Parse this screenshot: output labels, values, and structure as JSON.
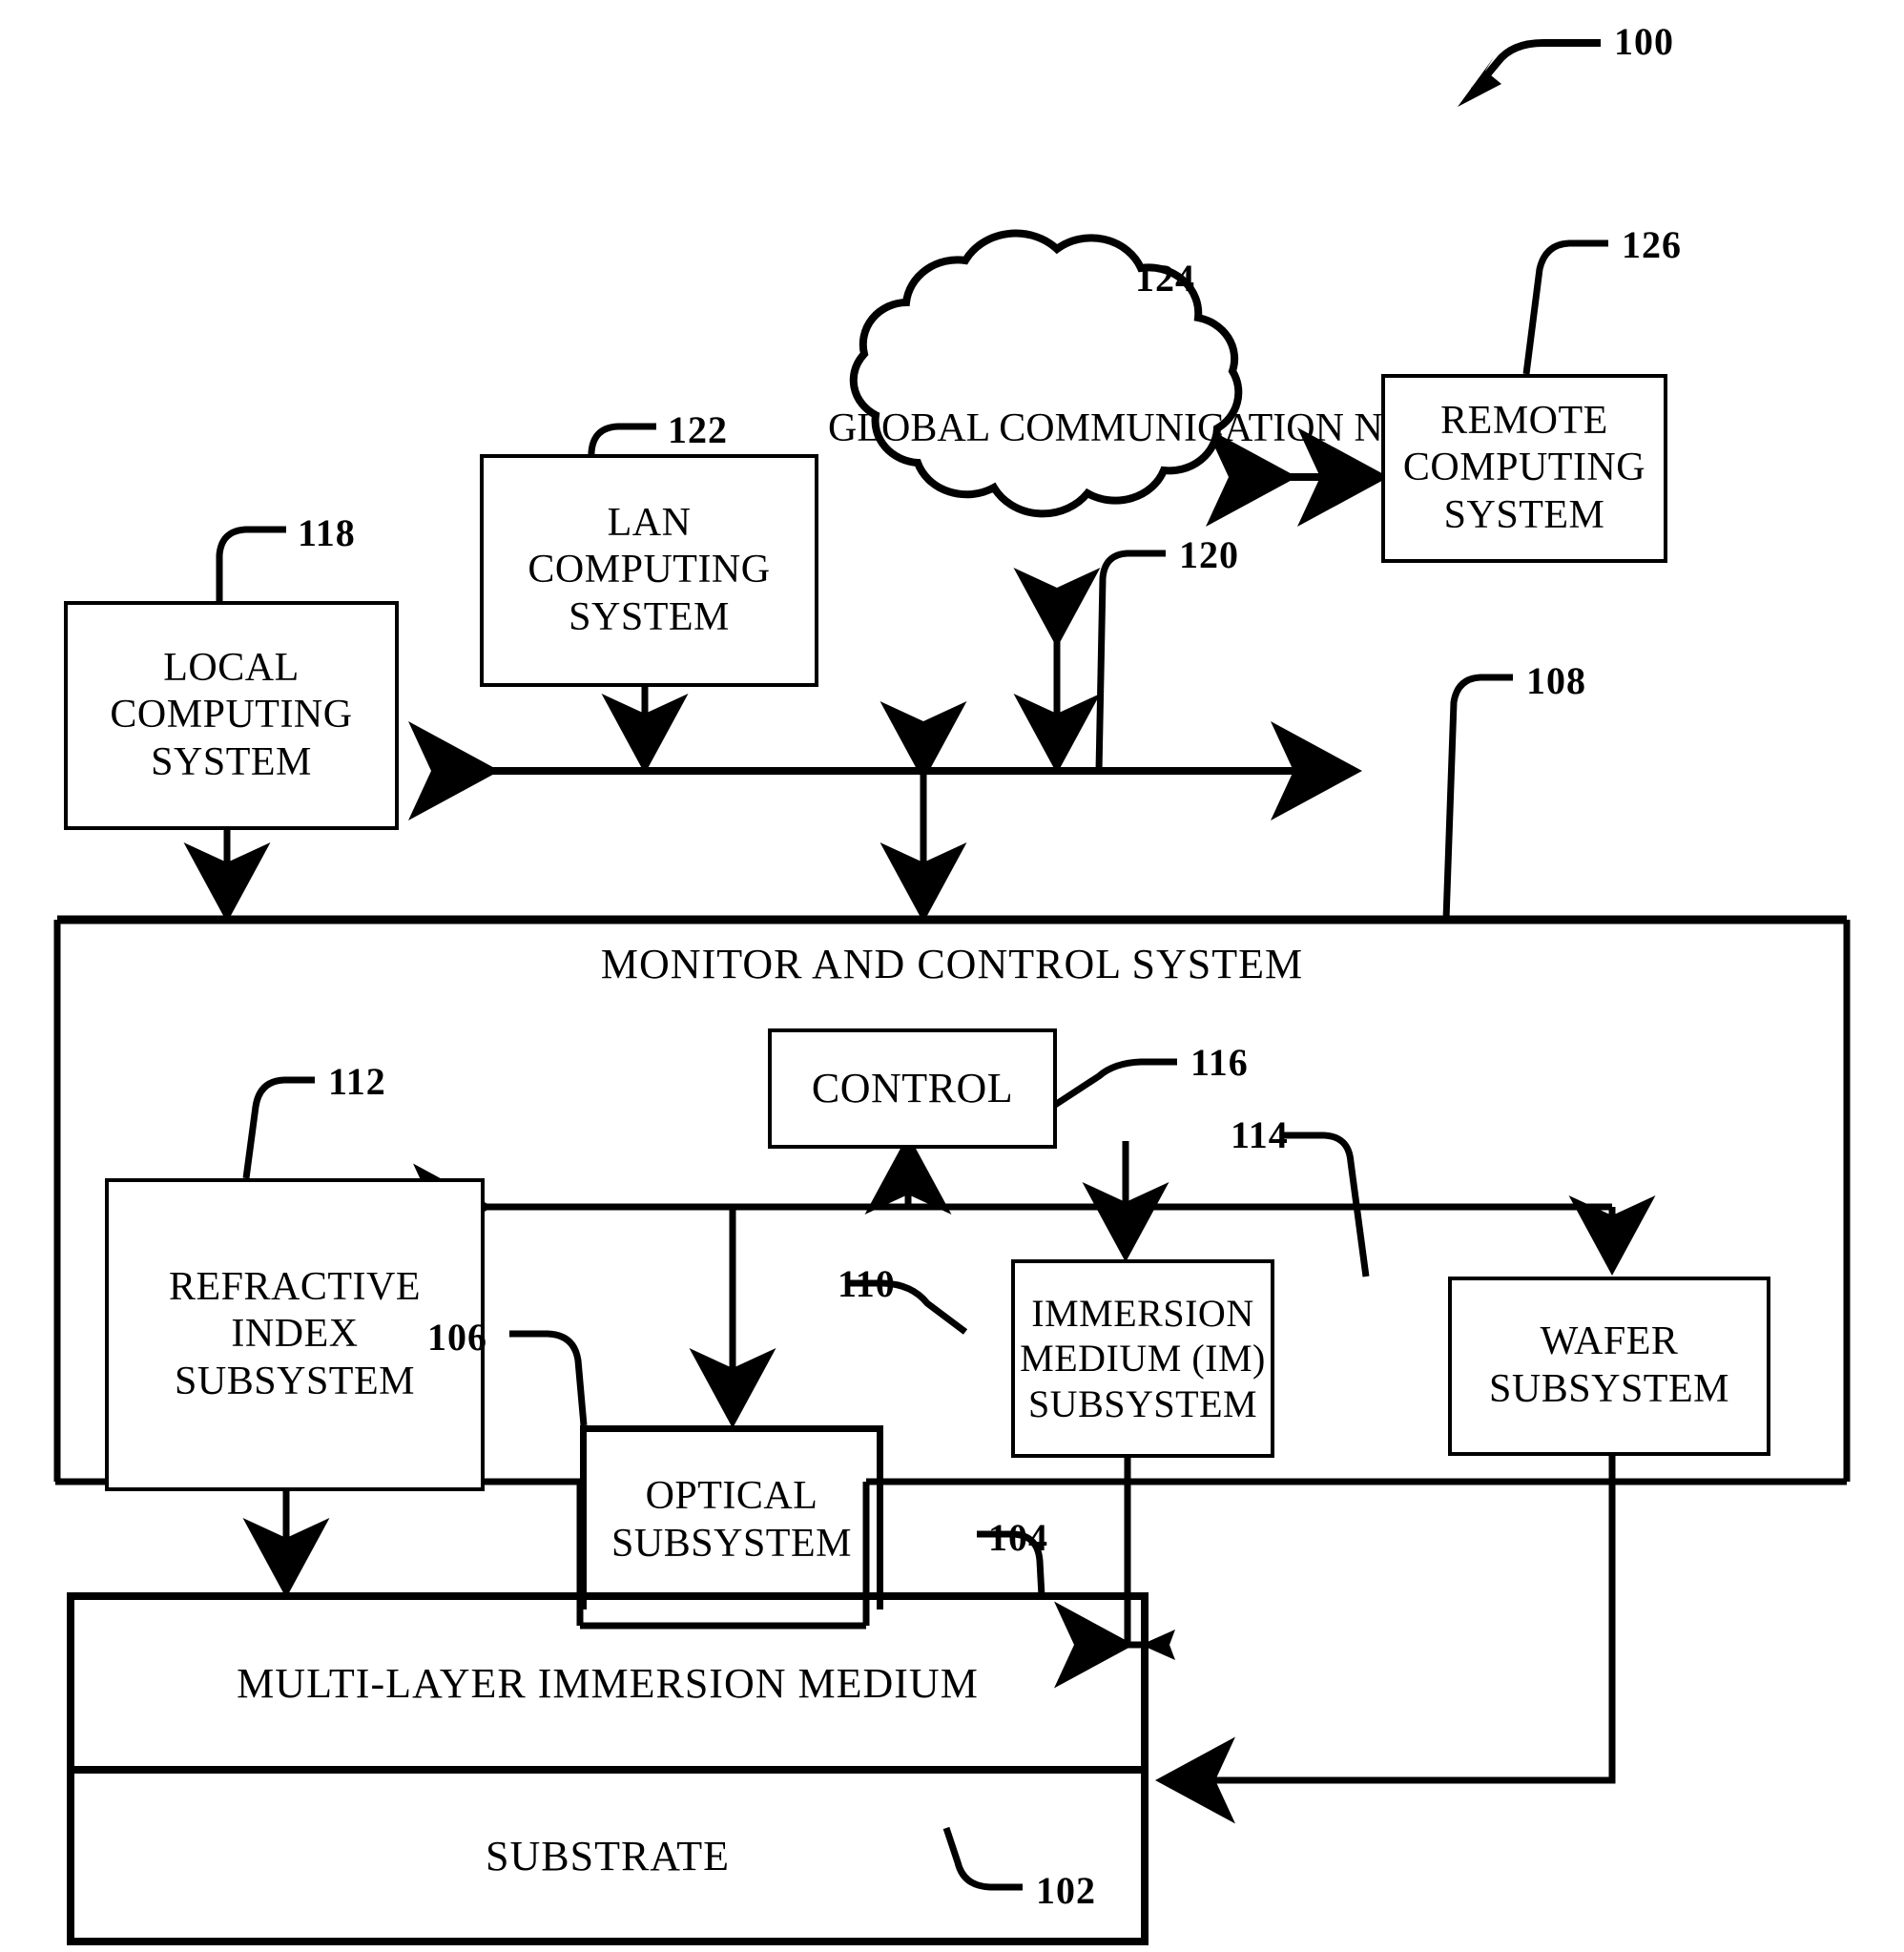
{
  "figure": {
    "ref_main": "100",
    "reference_numerals": {
      "system": "100",
      "substrate": "102",
      "multilayer_immersion_medium": "104",
      "optical_subsystem": "106",
      "monitor_and_control_system": "108",
      "immersion_medium_subsystem": "110",
      "refractive_index_subsystem": "112",
      "wafer_subsystem": "114",
      "control": "116",
      "local_computing_system": "118",
      "bus": "120",
      "lan_computing_system": "122",
      "global_communication_network": "124",
      "remote_computing_system": "126"
    }
  },
  "nodes": {
    "local_computing_system": {
      "ref": "118",
      "lines": [
        "LOCAL",
        "COMPUTING",
        "SYSTEM"
      ]
    },
    "lan_computing_system": {
      "ref": "122",
      "lines": [
        "LAN",
        "COMPUTING",
        "SYSTEM"
      ]
    },
    "global_communication_network": {
      "ref": "124",
      "lines": [
        "GLOBAL",
        "COMMUNICATION",
        "NETWORK"
      ]
    },
    "remote_computing_system": {
      "ref": "126",
      "lines": [
        "REMOTE",
        "COMPUTING",
        "SYSTEM"
      ]
    },
    "bus": {
      "ref": "120",
      "lines": []
    },
    "monitor_and_control_system": {
      "ref": "108",
      "lines": [
        "MONITOR AND CONTROL SYSTEM"
      ]
    },
    "control": {
      "ref": "116",
      "lines": [
        "CONTROL"
      ]
    },
    "refractive_index_subsystem": {
      "ref": "112",
      "lines": [
        "REFRACTIVE",
        "INDEX",
        "SUBSYSTEM"
      ]
    },
    "immersion_medium_subsystem": {
      "ref": "110",
      "lines": [
        "IMMERSION",
        "MEDIUM (IM)",
        "SUBSYSTEM"
      ]
    },
    "wafer_subsystem": {
      "ref": "114",
      "lines": [
        "WAFER",
        "SUBSYSTEM"
      ]
    },
    "optical_subsystem": {
      "ref": "106",
      "lines": [
        "OPTICAL",
        "SUBSYSTEM"
      ]
    },
    "multilayer_immersion_medium": {
      "ref": "104",
      "lines": [
        "MULTI-LAYER IMMERSION MEDIUM"
      ]
    },
    "substrate": {
      "ref": "102",
      "lines": [
        "SUBSTRATE"
      ]
    }
  },
  "colors": {
    "ink": "#000000",
    "paper": "#ffffff"
  }
}
